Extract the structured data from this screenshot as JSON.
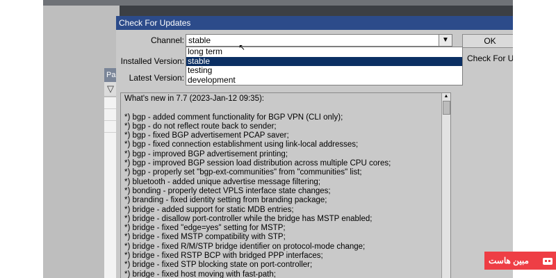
{
  "window": {
    "title": "Check For Updates"
  },
  "form": {
    "channel_label": "Channel:",
    "channel_value": "stable",
    "installed_label": "Installed Version:",
    "latest_label": "Latest Version:"
  },
  "dropdown": {
    "options": [
      "long term",
      "stable",
      "testing",
      "development"
    ],
    "selected": "stable"
  },
  "buttons": {
    "ok": "OK",
    "check": "Check For U"
  },
  "background_panel": {
    "tab": "Pa"
  },
  "notes": {
    "lines": [
      "What's new in 7.7 (2023-Jan-12 09:35):",
      "",
      "*) bgp - added comment functionality for BGP VPN (CLI only);",
      "*) bgp - do not reflect route back to sender;",
      "*) bgp - fixed BGP advertisement PCAP saver;",
      "*) bgp - fixed connection establishment using link-local addresses;",
      "*) bgp - improved BGP advertisement printing;",
      "*) bgp - improved BGP session load distribution across multiple CPU cores;",
      "*) bgp - properly set \"bgp-ext-communities\" from \"communities\" list;",
      "*) bluetooth - added unique advertise message filtering;",
      "*) bonding - properly detect VPLS interface state changes;",
      "*) branding - fixed identity setting from branding package;",
      "*) bridge - added support for static MDB entries;",
      "*) bridge - disallow port-controller while the bridge has MSTP enabled;",
      "*) bridge - fixed \"edge=yes\" setting for MSTP;",
      "*) bridge - fixed MSTP compatibility with STP;",
      "*) bridge - fixed R/M/STP bridge identifier on protocol-mode change;",
      "*) bridge - fixed RSTP BCP with bridged PPP interfaces;",
      "*) bridge - fixed STP blocking state on port-controller;",
      "*) bridge - fixed host moving with fast-path;"
    ]
  },
  "watermark": {
    "text": "مبین هاست"
  },
  "colors": {
    "titlebar": "#2c4b8a",
    "selection": "#0b2f63",
    "dialog_bg": "#c9c9c9",
    "watermark": "#ee3e45"
  }
}
